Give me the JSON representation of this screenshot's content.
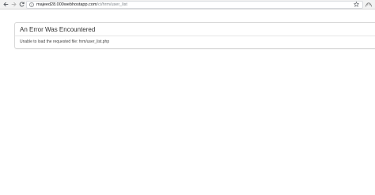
{
  "browser": {
    "url_host": "majeed28.000webhostapp.com",
    "url_path": "/ci/hrm/user_list",
    "icons": {
      "back": "arrow-left-icon",
      "forward": "arrow-right-icon",
      "reload": "reload-icon",
      "site_info": "info-icon",
      "bookmark": "star-icon",
      "menu": "extension-icon"
    }
  },
  "error": {
    "heading": "An Error Was Encountered",
    "message": "Unable to load the requested file: hrm/user_list.php"
  }
}
